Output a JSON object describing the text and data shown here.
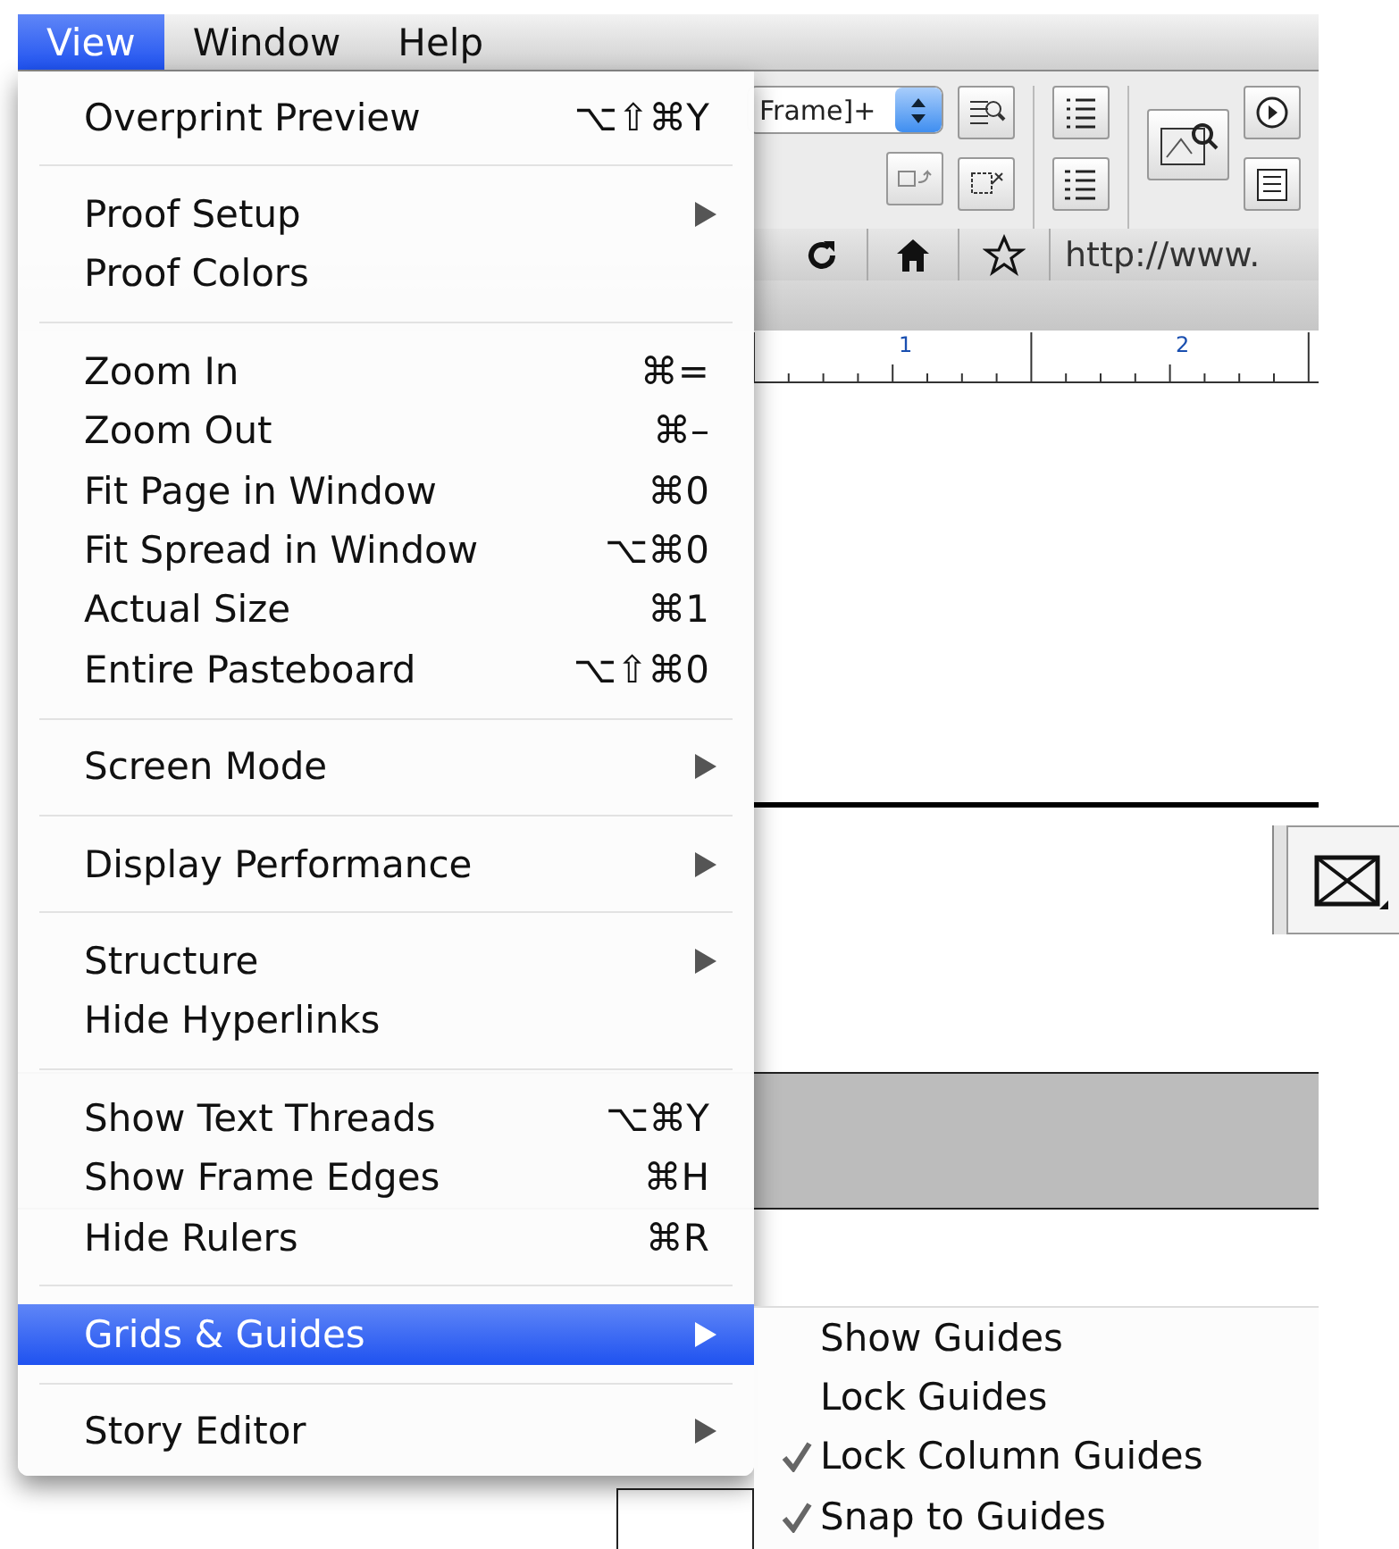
{
  "menubar": {
    "items": [
      {
        "label": "View",
        "selected": true
      },
      {
        "label": "Window",
        "selected": false
      },
      {
        "label": "Help",
        "selected": false
      }
    ]
  },
  "toolbar": {
    "style_dropdown": "Frame]+"
  },
  "browser_bar": {
    "address": "http://www."
  },
  "ruler": {
    "labels": [
      "1",
      "2"
    ]
  },
  "view_menu": {
    "groups": [
      [
        {
          "label": "Overprint Preview",
          "shortcut": "⌥⇧⌘Y",
          "submenu": false,
          "selected": false
        }
      ],
      [
        {
          "label": "Proof Setup",
          "submenu": true,
          "selected": false
        },
        {
          "label": "Proof Colors",
          "submenu": false,
          "selected": false
        }
      ],
      [
        {
          "label": "Zoom In",
          "shortcut": "⌘=",
          "submenu": false,
          "selected": false
        },
        {
          "label": "Zoom Out",
          "shortcut": "⌘–",
          "submenu": false,
          "selected": false
        },
        {
          "label": "Fit Page in Window",
          "shortcut": "⌘0",
          "submenu": false,
          "selected": false
        },
        {
          "label": "Fit Spread in Window",
          "shortcut": "⌥⌘0",
          "submenu": false,
          "selected": false
        },
        {
          "label": "Actual Size",
          "shortcut": "⌘1",
          "submenu": false,
          "selected": false
        },
        {
          "label": "Entire Pasteboard",
          "shortcut": "⌥⇧⌘0",
          "submenu": false,
          "selected": false
        }
      ],
      [
        {
          "label": "Screen Mode",
          "submenu": true,
          "selected": false
        }
      ],
      [
        {
          "label": "Display Performance",
          "submenu": true,
          "selected": false
        }
      ],
      [
        {
          "label": "Structure",
          "submenu": true,
          "selected": false
        },
        {
          "label": "Hide Hyperlinks",
          "submenu": false,
          "selected": false
        }
      ],
      [
        {
          "label": "Show Text Threads",
          "shortcut": "⌥⌘Y",
          "submenu": false,
          "selected": false
        },
        {
          "label": "Show Frame Edges",
          "shortcut": "⌘H",
          "submenu": false,
          "selected": false
        },
        {
          "label": "Hide Rulers",
          "shortcut": "⌘R",
          "submenu": false,
          "selected": false
        }
      ],
      [
        {
          "label": "Grids & Guides",
          "submenu": true,
          "selected": true
        }
      ],
      [
        {
          "label": "Story Editor",
          "submenu": true,
          "selected": false
        }
      ]
    ]
  },
  "grids_submenu": {
    "items": [
      {
        "label": "Show Guides",
        "checked": false
      },
      {
        "label": "Lock Guides",
        "checked": false
      },
      {
        "label": "Lock Column Guides",
        "checked": true
      },
      {
        "label": "Snap to Guides",
        "checked": true
      }
    ]
  }
}
